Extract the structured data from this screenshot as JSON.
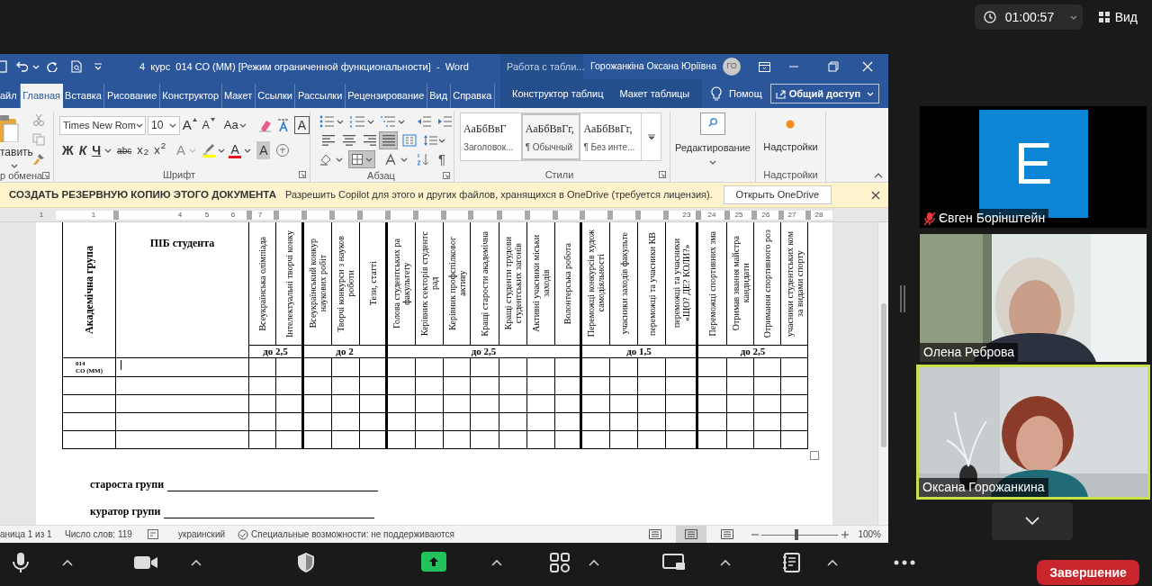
{
  "meeting": {
    "timer": "01:00:57",
    "view_button": "Вид",
    "end_button": "Завершение"
  },
  "word": {
    "title": "4  курс  014 СО (ММ) [Режим ограниченной функциональности]  -  Word",
    "context_group": "Работа с табли...",
    "user_name": "Горожанкіна Оксана Юріївна",
    "user_initials": "ГО",
    "tabs": [
      {
        "label": "айл",
        "selected": false
      },
      {
        "label": "Главная",
        "selected": true
      },
      {
        "label": "Вставка",
        "selected": false
      },
      {
        "label": "Рисование",
        "selected": false
      },
      {
        "label": "Конструктор",
        "selected": false
      },
      {
        "label": "Макет",
        "selected": false
      },
      {
        "label": "Ссылки",
        "selected": false
      },
      {
        "label": "Рассылки",
        "selected": false
      },
      {
        "label": "Рецензирование",
        "selected": false
      },
      {
        "label": "Вид",
        "selected": false
      },
      {
        "label": "Справка",
        "selected": false
      }
    ],
    "context_tabs": [
      {
        "label": "Конструктор таблиц",
        "selected": false
      },
      {
        "label": "Макет таблицы",
        "selected": false
      }
    ],
    "tell_me": "Помощ",
    "share_button": "Общий доступ",
    "ribbon": {
      "clipboard": {
        "paste_label": "тавить",
        "group_label": "р обмена"
      },
      "font": {
        "font_name": "Times New Rom",
        "font_size": "10",
        "row_1": [
          {
            "kind": "grow",
            "label": "A"
          },
          {
            "kind": "shrink",
            "label": "A"
          },
          {
            "kind": "case",
            "label": "Aa"
          },
          {
            "kind": "clear"
          },
          {
            "kind": "phonetic"
          },
          {
            "kind": "border",
            "label": "A"
          }
        ],
        "row_2": [
          {
            "kind": "bold",
            "label": "Ж"
          },
          {
            "kind": "italic",
            "label": "К"
          },
          {
            "kind": "underline",
            "label": "Ч"
          },
          {
            "kind": "strike",
            "label": "abc"
          },
          {
            "kind": "subscript",
            "label": "x$_{2}$"
          },
          {
            "kind": "superscript",
            "label": "x$^{2}$"
          },
          {
            "kind": "effects",
            "label": "A"
          },
          {
            "kind": "highlight",
            "color": "#ffff00"
          },
          {
            "kind": "color",
            "label": "A",
            "color": "#e81123"
          },
          {
            "kind": "shade",
            "label": "A"
          },
          {
            "kind": "enclose"
          }
        ],
        "group_label": "Шрифт"
      },
      "paragraph": {
        "alignment": [
          {
            "selected": false
          },
          {
            "selected": false
          },
          {
            "selected": false
          },
          {
            "selected": true
          }
        ],
        "borders_selected": true,
        "pilcrow": "¶",
        "group_label": "Абзац"
      },
      "styles": {
        "items": [
          {
            "preview": "АаБбВвГ",
            "name": "Заголовок...",
            "selected": false
          },
          {
            "preview": "АаБбВвГг,",
            "name": "¶ Обычный",
            "selected": true
          },
          {
            "preview": "АаБбВвГг,",
            "name": "¶ Без инте...",
            "selected": false
          }
        ],
        "group_label": "Стили"
      },
      "editing": {
        "label": "Редактирование"
      },
      "addins": {
        "label": "Надстройки",
        "group_label": "Надстройки"
      }
    },
    "banner": {
      "title": "СОЗДАТЬ РЕЗЕРВНУЮ КОПИЮ ЭТОГО ДОКУМЕНТА",
      "message": "Разрешить Copilot для этого и других файлов, хранящихся в OneDrive (требуется лицензия).",
      "button": "Открыть OneDrive"
    },
    "ruler": [
      "1",
      "1",
      "4",
      "5",
      "6",
      "7",
      "23",
      "24",
      "25",
      "26",
      "27",
      "28"
    ],
    "table": {
      "group_header": "Академічна група",
      "name_header": "ПІБ студента",
      "groups": [
        {
          "score": "до 2,5",
          "columns": [
            {
              "lines": [
                "Всеукраїнська олімпіада"
              ]
            },
            {
              "lines": [
                "Інтелектуальні творчі конку"
              ]
            }
          ]
        },
        {
          "score": "до 2",
          "columns": [
            {
              "lines": [
                "Всеукраїнський конкур",
                "наукових робіт"
              ]
            },
            {
              "lines": [
                "Творчі конкурси з науков",
                "роботи"
              ]
            },
            {
              "lines": [
                "Тези, статті"
              ]
            }
          ]
        },
        {
          "score": "до 2,5",
          "columns": [
            {
              "lines": [
                "Голова студентських ра",
                "факультету"
              ]
            },
            {
              "lines": [
                "Керівник секторів студентс",
                "рад"
              ]
            },
            {
              "lines": [
                "Керівник профспілковог",
                "активу"
              ]
            },
            {
              "lines": [
                "Кращі старости академічна"
              ]
            },
            {
              "lines": [
                "Кращі студенти трудови",
                "студентських загонів"
              ]
            },
            {
              "lines": [
                "Активні учасники міськи",
                "заходів"
              ]
            },
            {
              "lines": [
                "Волонтерська робота"
              ]
            }
          ]
        },
        {
          "score": "до 1,5",
          "columns": [
            {
              "lines": [
                "Переможці конкурсів худож",
                "самодіяльності"
              ]
            },
            {
              "lines": [
                "учасники заходів факульте"
              ]
            },
            {
              "lines": [
                "переможці та учасники КВ"
              ]
            },
            {
              "lines": [
                "переможці та учасники",
                "«ЩО? ДЕ? КОЛИ?»"
              ]
            }
          ]
        },
        {
          "score": "до 2,5",
          "columns": [
            {
              "lines": [
                "Переможці спортивних зма"
              ]
            },
            {
              "lines": [
                "Отримав звання майстра",
                "кандидати"
              ]
            },
            {
              "lines": [
                "Отримання спортивного роз"
              ]
            },
            {
              "lines": [
                "учасники студентських ком",
                "за видами спорту"
              ]
            }
          ]
        }
      ],
      "rows": [
        {
          "group": [
            "014",
            "СО (ММ)"
          ],
          "cursor": true
        },
        {
          "cursor": false
        },
        {
          "cursor": false
        },
        {
          "cursor": false
        },
        {
          "cursor": false
        }
      ]
    },
    "signatures": [
      "староста групи",
      "куратор групи"
    ],
    "status_bar": {
      "page": "аница 1 из 1",
      "words": "Число слов: 119",
      "language": "украинский",
      "accessibility": "Специальные возможности: не поддерживаются",
      "views": [
        {
          "selected": false
        },
        {
          "selected": true
        },
        {
          "selected": false
        }
      ],
      "zoom": {
        "level": 0.45,
        "label": "100%"
      }
    }
  },
  "participants": [
    {
      "kind": "avatar",
      "initial": "E",
      "name": "Євген Борінштейн",
      "muted": true,
      "speaking": false
    },
    {
      "kind": "video",
      "name": "Олена Реброва",
      "muted": false,
      "speaking": false
    },
    {
      "kind": "video",
      "name": "Оксана Горожанкина",
      "muted": false,
      "speaking": true
    }
  ]
}
